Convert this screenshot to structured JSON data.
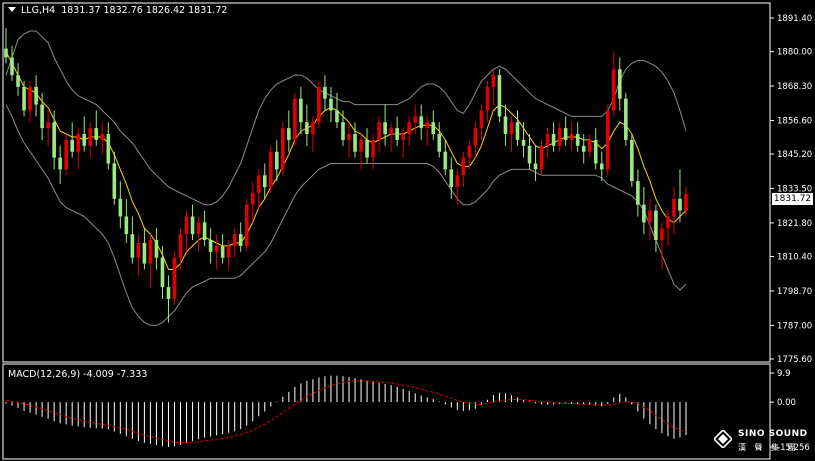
{
  "header": {
    "symbol": "LLG,H4",
    "ohlc": "1831.37 1832.76 1826.42 1831.72"
  },
  "macd": {
    "label": "MACD(12,26,9) -4.009 -7.333",
    "axis_ticks": [
      "9.9",
      "0.00",
      "-15.256"
    ],
    "range": [
      -15.256,
      9.9
    ]
  },
  "current_price": "1831.72",
  "logo": {
    "line1": "SINO SOUND",
    "line2": "漢 聲 集 團"
  },
  "colors": {
    "background": "#000000",
    "bull": "#e00000",
    "bear": "#9ce884",
    "ma": "#ffd400",
    "bands": "#8c8c8c",
    "macd_hist": "#ffffff",
    "macd_signal": "#e00000",
    "axis": "#ffffff"
  },
  "chart_data": {
    "type": "candlestick",
    "symbol": "LLG",
    "timeframe": "H4",
    "y_ticks": [
      "1891.40",
      "1880.00",
      "1868.30",
      "1856.60",
      "1845.20",
      "1833.50",
      "1821.80",
      "1810.40",
      "1798.70",
      "1787.00",
      "1775.60"
    ],
    "ylim": [
      1775.6,
      1891.4
    ],
    "candles": [
      [
        1881.0,
        1888.0,
        1876.0,
        1878.0
      ],
      [
        1878.0,
        1882.0,
        1870.0,
        1872.0
      ],
      [
        1872.0,
        1876.0,
        1865.0,
        1868.0
      ],
      [
        1868.0,
        1870.0,
        1858.0,
        1860.0
      ],
      [
        1860.0,
        1870.0,
        1856.0,
        1868.0
      ],
      [
        1868.0,
        1872.0,
        1858.0,
        1862.0
      ],
      [
        1862.0,
        1866.0,
        1850.0,
        1854.0
      ],
      [
        1854.0,
        1860.0,
        1848.0,
        1856.0
      ],
      [
        1856.0,
        1860.0,
        1840.0,
        1844.0
      ],
      [
        1844.0,
        1848.0,
        1835.0,
        1840.0
      ],
      [
        1840.0,
        1852.0,
        1838.0,
        1850.0
      ],
      [
        1850.0,
        1856.0,
        1844.0,
        1846.0
      ],
      [
        1846.0,
        1854.0,
        1840.0,
        1852.0
      ],
      [
        1852.0,
        1858.0,
        1846.0,
        1848.0
      ],
      [
        1848.0,
        1856.0,
        1844.0,
        1854.0
      ],
      [
        1854.0,
        1860.0,
        1848.0,
        1850.0
      ],
      [
        1850.0,
        1856.0,
        1845.0,
        1852.0
      ],
      [
        1852.0,
        1856.0,
        1840.0,
        1842.0
      ],
      [
        1842.0,
        1846.0,
        1828.0,
        1830.0
      ],
      [
        1830.0,
        1836.0,
        1820.0,
        1824.0
      ],
      [
        1824.0,
        1830.0,
        1815.0,
        1818.0
      ],
      [
        1818.0,
        1824.0,
        1808.0,
        1810.0
      ],
      [
        1810.0,
        1818.0,
        1804.0,
        1815.0
      ],
      [
        1815.0,
        1820.0,
        1806.0,
        1808.0
      ],
      [
        1808.0,
        1818.0,
        1800.0,
        1816.0
      ],
      [
        1816.0,
        1820.0,
        1806.0,
        1810.0
      ],
      [
        1810.0,
        1814.0,
        1796.0,
        1800.0
      ],
      [
        1800.0,
        1804.0,
        1788.0,
        1796.0
      ],
      [
        1796.0,
        1812.0,
        1794.0,
        1810.0
      ],
      [
        1810.0,
        1820.0,
        1806.0,
        1818.0
      ],
      [
        1818.0,
        1826.0,
        1812.0,
        1824.0
      ],
      [
        1824.0,
        1828.0,
        1816.0,
        1818.0
      ],
      [
        1818.0,
        1824.0,
        1812.0,
        1822.0
      ],
      [
        1822.0,
        1826.0,
        1814.0,
        1816.0
      ],
      [
        1816.0,
        1820.0,
        1808.0,
        1812.0
      ],
      [
        1812.0,
        1818.0,
        1806.0,
        1814.0
      ],
      [
        1814.0,
        1818.0,
        1808.0,
        1810.0
      ],
      [
        1810.0,
        1816.0,
        1806.0,
        1814.0
      ],
      [
        1814.0,
        1820.0,
        1810.0,
        1818.0
      ],
      [
        1818.0,
        1822.0,
        1812.0,
        1814.0
      ],
      [
        1814.0,
        1830.0,
        1812.0,
        1828.0
      ],
      [
        1828.0,
        1836.0,
        1822.0,
        1832.0
      ],
      [
        1832.0,
        1840.0,
        1826.0,
        1838.0
      ],
      [
        1838.0,
        1842.0,
        1830.0,
        1834.0
      ],
      [
        1834.0,
        1848.0,
        1832.0,
        1846.0
      ],
      [
        1846.0,
        1850.0,
        1836.0,
        1840.0
      ],
      [
        1840.0,
        1856.0,
        1838.0,
        1854.0
      ],
      [
        1854.0,
        1860.0,
        1846.0,
        1850.0
      ],
      [
        1850.0,
        1866.0,
        1848.0,
        1864.0
      ],
      [
        1864.0,
        1868.0,
        1852.0,
        1856.0
      ],
      [
        1856.0,
        1862.0,
        1848.0,
        1852.0
      ],
      [
        1852.0,
        1858.0,
        1846.0,
        1856.0
      ],
      [
        1856.0,
        1870.0,
        1854.0,
        1868.0
      ],
      [
        1868.0,
        1872.0,
        1860.0,
        1864.0
      ],
      [
        1864.0,
        1868.0,
        1856.0,
        1860.0
      ],
      [
        1860.0,
        1866.0,
        1854.0,
        1856.0
      ],
      [
        1856.0,
        1860.0,
        1848.0,
        1850.0
      ],
      [
        1850.0,
        1856.0,
        1844.0,
        1852.0
      ],
      [
        1852.0,
        1856.0,
        1844.0,
        1846.0
      ],
      [
        1846.0,
        1852.0,
        1840.0,
        1850.0
      ],
      [
        1850.0,
        1854.0,
        1842.0,
        1844.0
      ],
      [
        1844.0,
        1852.0,
        1840.0,
        1850.0
      ],
      [
        1850.0,
        1858.0,
        1846.0,
        1856.0
      ],
      [
        1856.0,
        1862.0,
        1848.0,
        1852.0
      ],
      [
        1852.0,
        1856.0,
        1846.0,
        1854.0
      ],
      [
        1854.0,
        1858.0,
        1848.0,
        1850.0
      ],
      [
        1850.0,
        1854.0,
        1844.0,
        1852.0
      ],
      [
        1852.0,
        1858.0,
        1848.0,
        1856.0
      ],
      [
        1856.0,
        1862.0,
        1852.0,
        1858.0
      ],
      [
        1858.0,
        1862.0,
        1850.0,
        1854.0
      ],
      [
        1854.0,
        1858.0,
        1848.0,
        1856.0
      ],
      [
        1856.0,
        1860.0,
        1850.0,
        1852.0
      ],
      [
        1852.0,
        1856.0,
        1844.0,
        1846.0
      ],
      [
        1846.0,
        1850.0,
        1838.0,
        1840.0
      ],
      [
        1840.0,
        1844.0,
        1830.0,
        1834.0
      ],
      [
        1834.0,
        1840.0,
        1828.0,
        1838.0
      ],
      [
        1838.0,
        1846.0,
        1834.0,
        1844.0
      ],
      [
        1844.0,
        1850.0,
        1840.0,
        1848.0
      ],
      [
        1848.0,
        1856.0,
        1844.0,
        1854.0
      ],
      [
        1854.0,
        1862.0,
        1850.0,
        1860.0
      ],
      [
        1860.0,
        1870.0,
        1856.0,
        1868.0
      ],
      [
        1868.0,
        1874.0,
        1862.0,
        1872.0
      ],
      [
        1872.0,
        1874.0,
        1856.0,
        1858.0
      ],
      [
        1858.0,
        1862.0,
        1848.0,
        1852.0
      ],
      [
        1852.0,
        1858.0,
        1846.0,
        1856.0
      ],
      [
        1856.0,
        1860.0,
        1848.0,
        1850.0
      ],
      [
        1850.0,
        1856.0,
        1844.0,
        1848.0
      ],
      [
        1848.0,
        1852.0,
        1840.0,
        1842.0
      ],
      [
        1842.0,
        1848.0,
        1836.0,
        1840.0
      ],
      [
        1840.0,
        1850.0,
        1838.0,
        1848.0
      ],
      [
        1848.0,
        1854.0,
        1844.0,
        1852.0
      ],
      [
        1852.0,
        1856.0,
        1846.0,
        1848.0
      ],
      [
        1848.0,
        1856.0,
        1846.0,
        1854.0
      ],
      [
        1854.0,
        1858.0,
        1848.0,
        1850.0
      ],
      [
        1850.0,
        1856.0,
        1846.0,
        1852.0
      ],
      [
        1852.0,
        1856.0,
        1846.0,
        1848.0
      ],
      [
        1848.0,
        1852.0,
        1842.0,
        1846.0
      ],
      [
        1846.0,
        1852.0,
        1844.0,
        1850.0
      ],
      [
        1850.0,
        1854.0,
        1840.0,
        1842.0
      ],
      [
        1842.0,
        1846.0,
        1836.0,
        1840.0
      ],
      [
        1840.0,
        1862.0,
        1838.0,
        1860.0
      ],
      [
        1860.0,
        1880.0,
        1858.0,
        1874.0
      ],
      [
        1874.0,
        1878.0,
        1860.0,
        1864.0
      ],
      [
        1864.0,
        1866.0,
        1848.0,
        1850.0
      ],
      [
        1850.0,
        1852.0,
        1834.0,
        1836.0
      ],
      [
        1836.0,
        1840.0,
        1824.0,
        1828.0
      ],
      [
        1828.0,
        1834.0,
        1818.0,
        1822.0
      ],
      [
        1822.0,
        1830.0,
        1816.0,
        1826.0
      ],
      [
        1826.0,
        1828.0,
        1812.0,
        1816.0
      ],
      [
        1816.0,
        1822.0,
        1806.0,
        1820.0
      ],
      [
        1820.0,
        1826.0,
        1814.0,
        1824.0
      ],
      [
        1824.0,
        1834.0,
        1818.0,
        1830.0
      ],
      [
        1830.0,
        1840.0,
        1822.0,
        1826.0
      ],
      [
        1826.0,
        1834.0,
        1824.0,
        1831.72
      ]
    ],
    "ma": [
      1880,
      1876,
      1872,
      1868,
      1867,
      1866,
      1863,
      1861,
      1857,
      1853,
      1852,
      1851,
      1851,
      1850,
      1851,
      1851,
      1851,
      1849,
      1845,
      1840,
      1835,
      1829,
      1825,
      1820,
      1818,
      1815,
      1811,
      1806,
      1806,
      1808,
      1812,
      1814,
      1816,
      1817,
      1816,
      1815,
      1814,
      1814,
      1815,
      1815,
      1818,
      1822,
      1827,
      1830,
      1834,
      1837,
      1841,
      1845,
      1850,
      1853,
      1854,
      1855,
      1858,
      1860,
      1861,
      1860,
      1858,
      1856,
      1853,
      1852,
      1850,
      1849,
      1850,
      1851,
      1852,
      1852,
      1852,
      1853,
      1854,
      1855,
      1855,
      1855,
      1853,
      1850,
      1846,
      1842,
      1841,
      1841,
      1844,
      1848,
      1854,
      1860,
      1862,
      1861,
      1859,
      1857,
      1854,
      1851,
      1848,
      1847,
      1848,
      1849,
      1850,
      1851,
      1851,
      1851,
      1850,
      1850,
      1849,
      1847,
      1849,
      1853,
      1856,
      1855,
      1852,
      1847,
      1841,
      1836,
      1830,
      1826,
      1823,
      1822,
      1824,
      1826
    ],
    "bb_upper": [
      1872,
      1878,
      1884,
      1886,
      1887,
      1887,
      1885,
      1883,
      1878,
      1874,
      1870,
      1867,
      1865,
      1864,
      1863,
      1862,
      1860,
      1858,
      1856,
      1853,
      1851,
      1849,
      1846,
      1843,
      1840,
      1838,
      1836,
      1834,
      1833,
      1832,
      1831,
      1830,
      1829,
      1828,
      1828,
      1829,
      1831,
      1834,
      1838,
      1842,
      1848,
      1854,
      1860,
      1864,
      1867,
      1869,
      1870,
      1871,
      1872,
      1872,
      1871,
      1869,
      1867,
      1866,
      1865,
      1864,
      1863,
      1863,
      1862,
      1862,
      1862,
      1862,
      1862,
      1862,
      1862,
      1862,
      1863,
      1864,
      1866,
      1868,
      1869,
      1869,
      1868,
      1866,
      1863,
      1860,
      1859,
      1862,
      1866,
      1870,
      1872,
      1874,
      1875,
      1874,
      1872,
      1870,
      1868,
      1866,
      1864,
      1863,
      1862,
      1861,
      1860,
      1859,
      1858,
      1858,
      1858,
      1858,
      1858,
      1858,
      1860,
      1864,
      1870,
      1874,
      1876,
      1877,
      1877,
      1876,
      1875,
      1873,
      1870,
      1866,
      1860,
      1853
    ],
    "bb_lower": [
      1862,
      1858,
      1853,
      1849,
      1846,
      1843,
      1840,
      1837,
      1833,
      1829,
      1827,
      1826,
      1825,
      1824,
      1822,
      1820,
      1818,
      1815,
      1810,
      1804,
      1798,
      1793,
      1790,
      1788,
      1787,
      1787,
      1788,
      1790,
      1792,
      1795,
      1798,
      1800,
      1801,
      1802,
      1803,
      1803,
      1803,
      1803,
      1803,
      1804,
      1806,
      1808,
      1810,
      1812,
      1815,
      1819,
      1823,
      1827,
      1831,
      1834,
      1836,
      1838,
      1840,
      1841,
      1842,
      1842,
      1842,
      1842,
      1842,
      1842,
      1842,
      1842,
      1842,
      1842,
      1842,
      1842,
      1842,
      1842,
      1842,
      1842,
      1842,
      1841,
      1839,
      1836,
      1833,
      1830,
      1828,
      1828,
      1829,
      1831,
      1833,
      1836,
      1838,
      1839,
      1840,
      1840,
      1840,
      1840,
      1839,
      1838,
      1838,
      1838,
      1838,
      1838,
      1838,
      1838,
      1838,
      1838,
      1838,
      1837,
      1835,
      1834,
      1833,
      1832,
      1831,
      1829,
      1826,
      1821,
      1816,
      1811,
      1806,
      1801,
      1799,
      1801
    ],
    "macd_hist": [
      -0.5,
      -1.2,
      -2.0,
      -3.0,
      -3.6,
      -4.2,
      -5.0,
      -5.6,
      -6.5,
      -7.2,
      -7.6,
      -8.0,
      -8.2,
      -8.5,
      -8.7,
      -8.9,
      -9.0,
      -9.3,
      -10.0,
      -10.8,
      -11.6,
      -12.5,
      -13.2,
      -13.8,
      -14.2,
      -14.6,
      -15.0,
      -15.2,
      -15.0,
      -14.5,
      -13.8,
      -13.2,
      -12.6,
      -12.1,
      -11.7,
      -11.3,
      -10.9,
      -10.4,
      -9.9,
      -9.2,
      -8.0,
      -6.5,
      -4.8,
      -3.2,
      -1.5,
      0.2,
      1.8,
      3.5,
      5.2,
      6.4,
      7.2,
      7.8,
      8.4,
      8.8,
      9.0,
      9.0,
      8.8,
      8.5,
      8.2,
      7.8,
      7.4,
      7.0,
      6.6,
      6.2,
      5.8,
      5.2,
      4.5,
      3.8,
      3.0,
      2.2,
      1.6,
      1.0,
      0.2,
      -0.8,
      -1.8,
      -2.6,
      -3.0,
      -2.8,
      -2.2,
      -1.0,
      0.8,
      2.4,
      3.2,
      3.0,
      2.4,
      1.6,
      0.8,
      0.2,
      -0.4,
      -0.8,
      -0.9,
      -0.8,
      -0.7,
      -0.6,
      -0.6,
      -0.7,
      -0.9,
      -1.0,
      -1.2,
      -1.4,
      -0.6,
      1.6,
      2.8,
      1.6,
      -0.8,
      -3.2,
      -5.6,
      -7.5,
      -9.2,
      -10.6,
      -11.6,
      -12.4,
      -12.0,
      -11.2
    ],
    "macd_signal": [
      0.6,
      0.3,
      -0.1,
      -0.6,
      -1.1,
      -1.7,
      -2.3,
      -2.9,
      -3.6,
      -4.3,
      -4.9,
      -5.5,
      -6.0,
      -6.4,
      -6.9,
      -7.2,
      -7.6,
      -7.9,
      -8.3,
      -8.8,
      -9.3,
      -9.9,
      -10.6,
      -11.2,
      -11.7,
      -12.3,
      -12.8,
      -13.2,
      -13.6,
      -13.8,
      -13.8,
      -13.7,
      -13.5,
      -13.2,
      -12.9,
      -12.6,
      -12.3,
      -11.9,
      -11.5,
      -11.0,
      -10.4,
      -9.6,
      -8.6,
      -7.5,
      -6.2,
      -4.9,
      -3.5,
      -2.1,
      -0.7,
      0.6,
      1.8,
      2.9,
      3.9,
      4.8,
      5.6,
      6.2,
      6.7,
      7.0,
      7.2,
      7.2,
      7.2,
      7.1,
      6.9,
      6.7,
      6.5,
      6.2,
      5.8,
      5.4,
      4.9,
      4.4,
      3.9,
      3.3,
      2.7,
      2.0,
      1.3,
      0.6,
      0.0,
      -0.4,
      -0.7,
      -0.7,
      -0.4,
      0.0,
      0.4,
      0.7,
      0.9,
      0.9,
      0.8,
      0.6,
      0.4,
      0.2,
      0.0,
      -0.2,
      -0.3,
      -0.4,
      -0.5,
      -0.6,
      -0.7,
      -0.8,
      -0.9,
      -1.0,
      -1.0,
      -0.7,
      -0.2,
      0.2,
      0.0,
      -0.6,
      -1.7,
      -3.0,
      -4.5,
      -6.0,
      -7.4,
      -8.7,
      -9.5,
      -10.0
    ]
  }
}
